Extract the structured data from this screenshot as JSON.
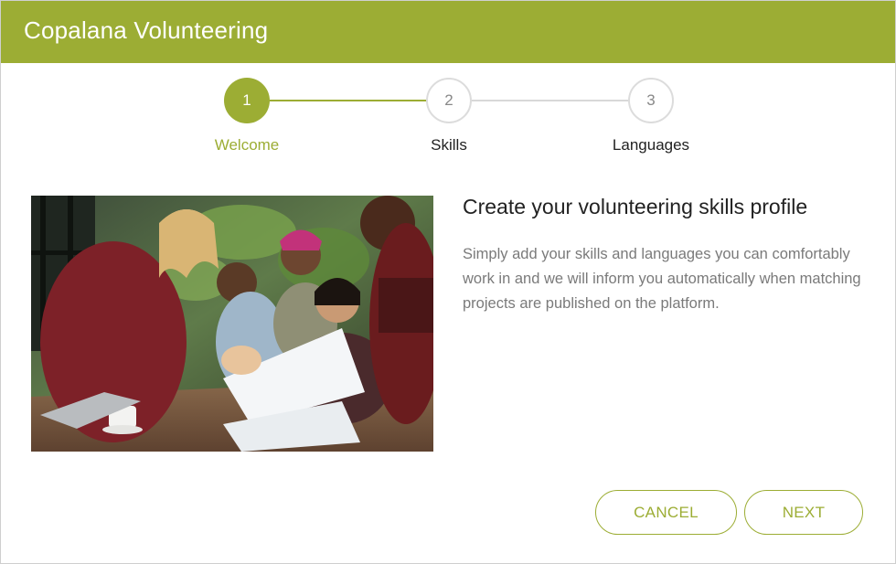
{
  "header": {
    "title": "Copalana Volunteering"
  },
  "stepper": {
    "steps": [
      {
        "number": "1",
        "label": "Welcome",
        "state": "active"
      },
      {
        "number": "2",
        "label": "Skills",
        "state": "inactive"
      },
      {
        "number": "3",
        "label": "Languages",
        "state": "inactive"
      }
    ]
  },
  "content": {
    "title": "Create your volunteering skills profile",
    "body": "Simply add your skills and languages you can comfortably work in and we will inform you automatically when matching projects are published on the platform."
  },
  "actions": {
    "cancel_label": "CANCEL",
    "next_label": "NEXT"
  },
  "colors": {
    "accent": "#9cad34",
    "text": "#222222",
    "muted": "#7a7a7a",
    "inactive_border": "#dcdcdc"
  }
}
